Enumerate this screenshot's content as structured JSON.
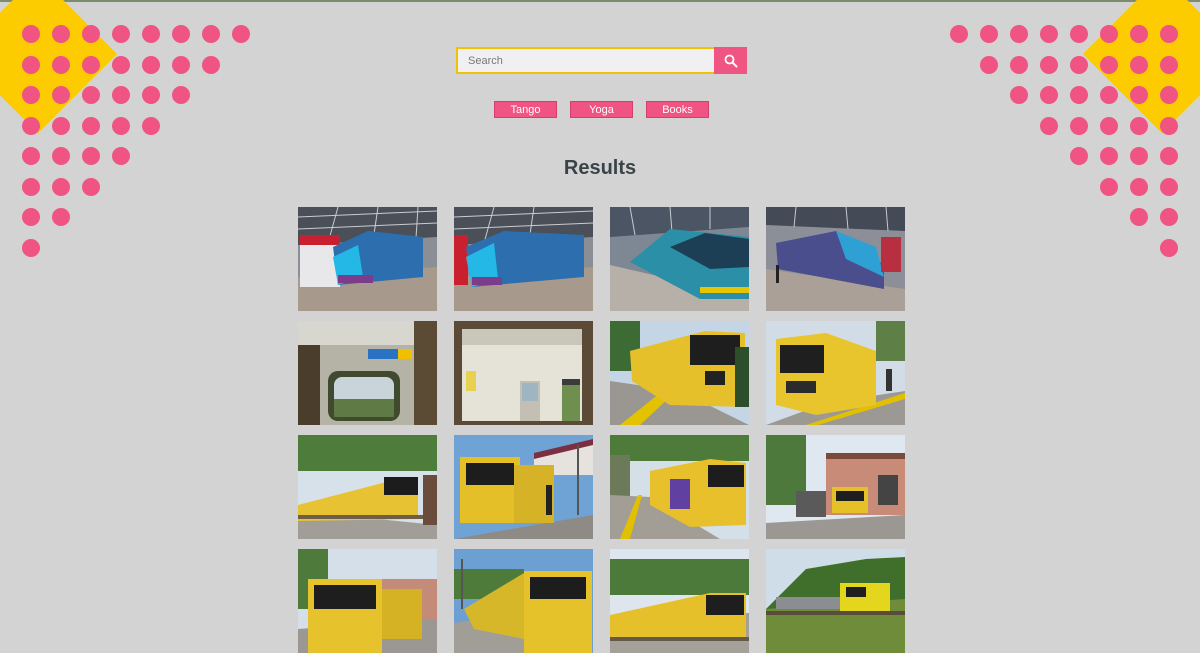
{
  "search": {
    "placeholder": "Search",
    "value": "",
    "button_icon": "search-icon"
  },
  "tags": [
    {
      "label": "Tango"
    },
    {
      "label": "Yoga"
    },
    {
      "label": "Books"
    }
  ],
  "results": {
    "title": "Results",
    "items": [
      {
        "description": "blue-train-station-1"
      },
      {
        "description": "blue-train-station-2"
      },
      {
        "description": "teal-train-station"
      },
      {
        "description": "purple-train-station"
      },
      {
        "description": "train-window-interior"
      },
      {
        "description": "train-cab-interior"
      },
      {
        "description": "yellow-train-platform-1"
      },
      {
        "description": "yellow-train-platform-2"
      },
      {
        "description": "yellow-train-trees"
      },
      {
        "description": "yellow-train-canopy"
      },
      {
        "description": "yellow-train-platform-3"
      },
      {
        "description": "yellow-train-building"
      },
      {
        "description": "yellow-train-house"
      },
      {
        "description": "yellow-train-blue-sky"
      },
      {
        "description": "yellow-train-hedge"
      },
      {
        "description": "yellow-freight-loco"
      }
    ]
  },
  "colors": {
    "accent": "#ef5482",
    "yellow": "#fccc00",
    "background": "#d3d3d3",
    "title": "#3a4448"
  }
}
